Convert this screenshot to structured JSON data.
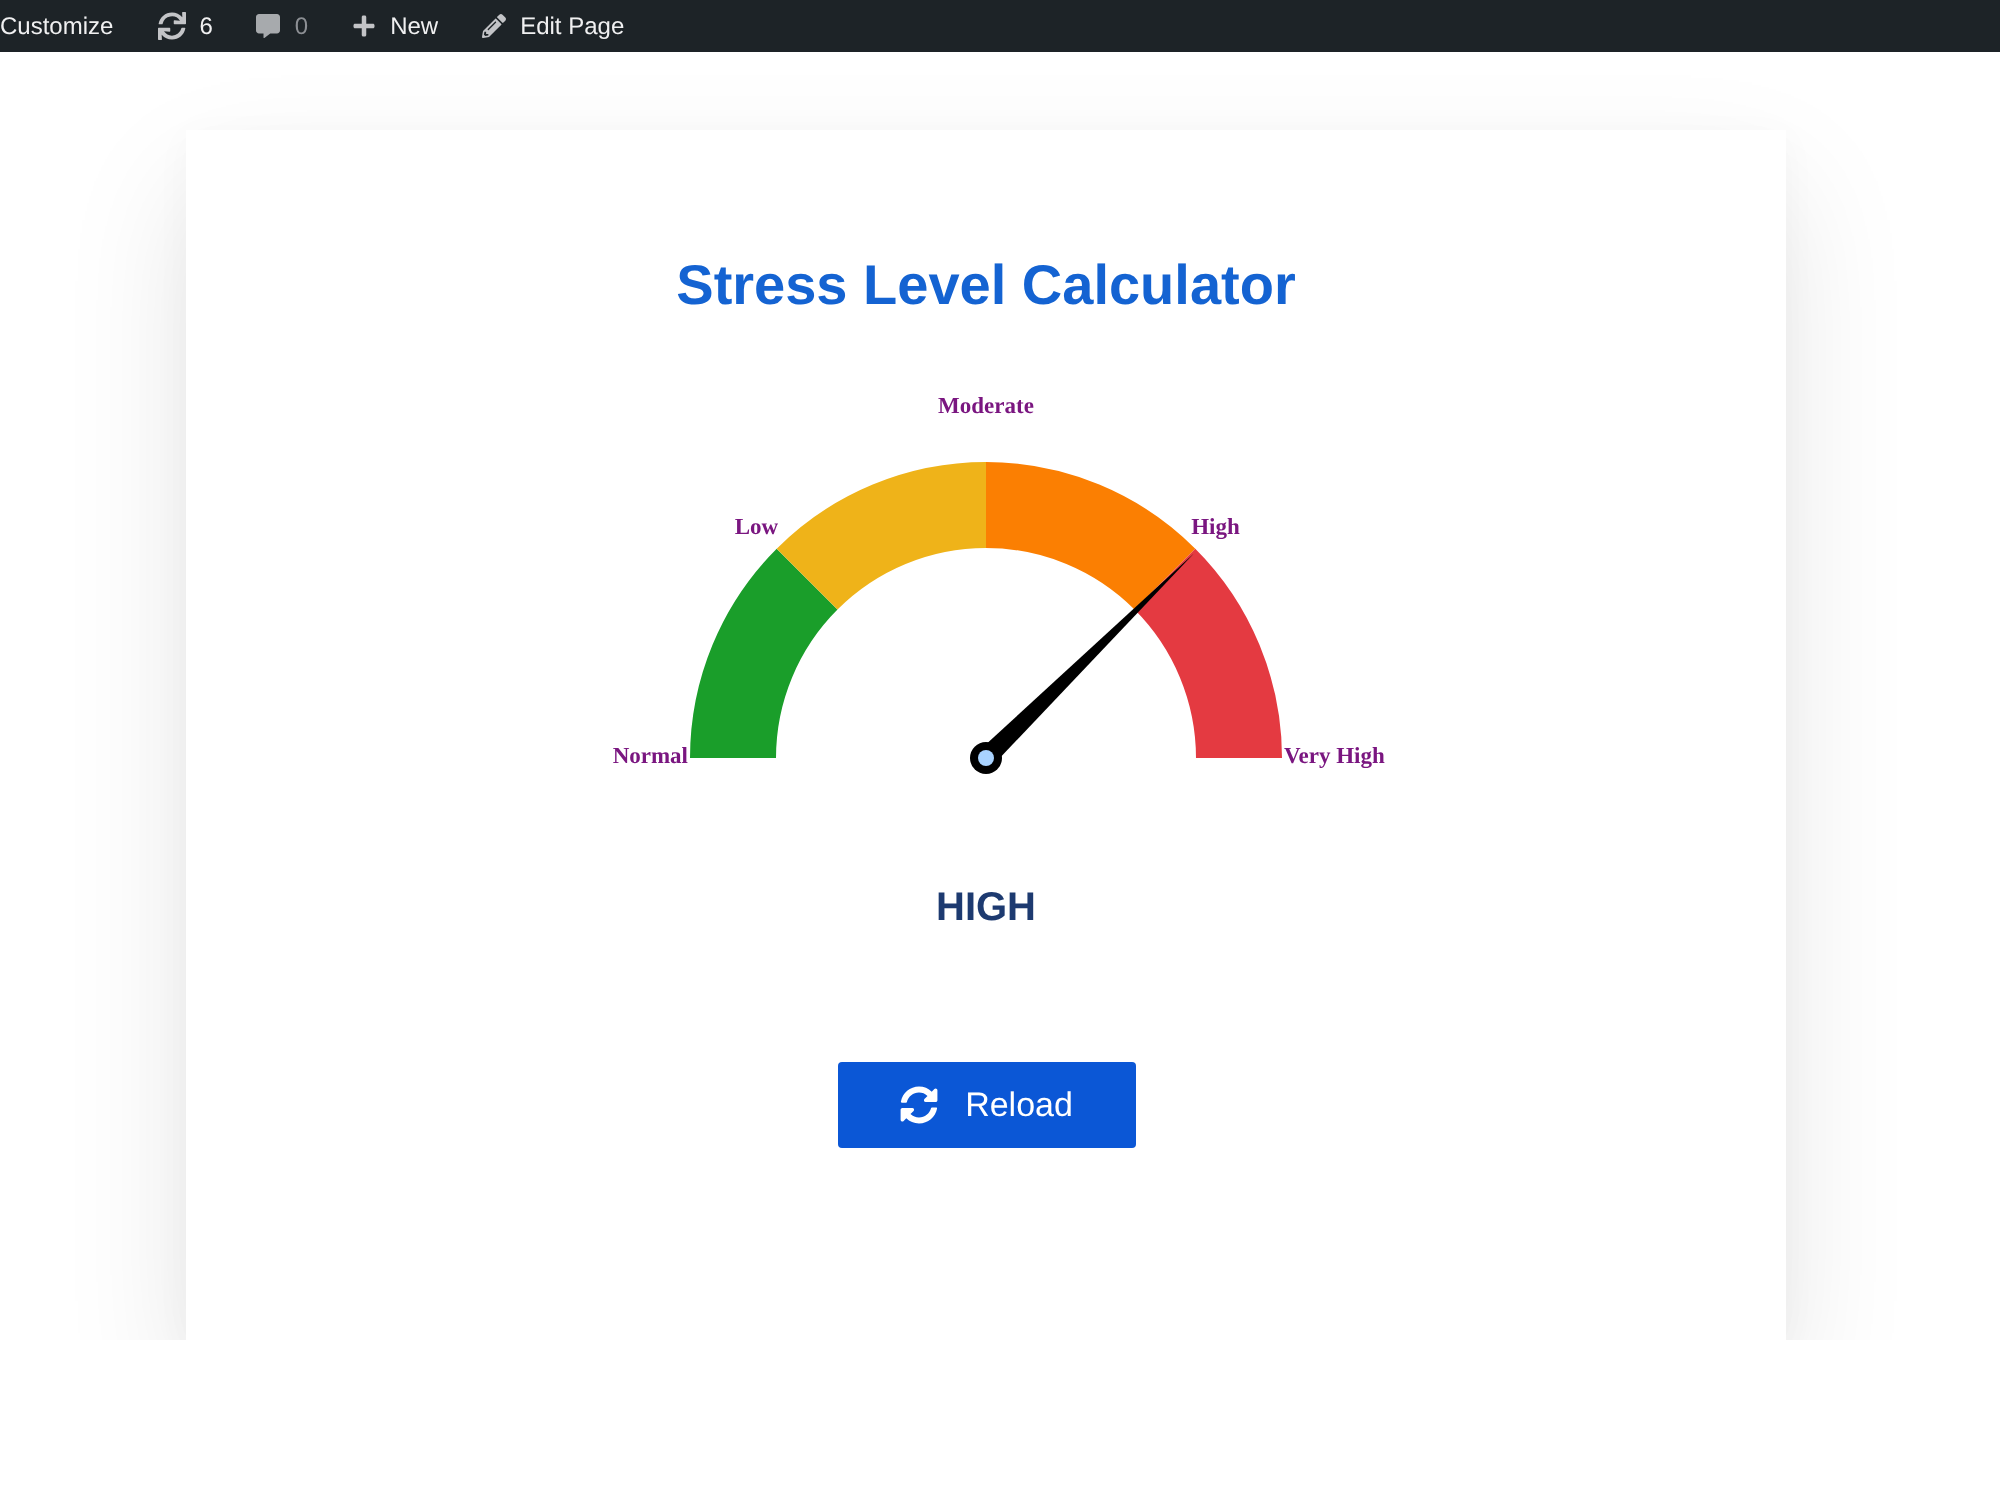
{
  "admin_bar": {
    "items": [
      {
        "kind": "customize",
        "text": "Customize"
      },
      {
        "kind": "updates",
        "text": "6"
      },
      {
        "kind": "comments",
        "text": "0"
      },
      {
        "kind": "new",
        "text": "New"
      },
      {
        "kind": "edit",
        "text": "Edit Page"
      }
    ]
  },
  "calculator": {
    "title": "Stress Level Calculator",
    "chart_data": [
      {
        "type": "donut",
        "categories": [
          "Normal",
          "Low",
          "Moderate",
          "High"
        ],
        "values": [
          25,
          25,
          25,
          25
        ],
        "colors": [
          "#1a9e2a",
          "#efb319",
          "#fb7f02",
          "#e43a41"
        ],
        "annotations": [
          "Very High"
        ],
        "needle": "High"
      }
    ],
    "result": "HIGH",
    "button": {
      "label": "Reload"
    }
  }
}
